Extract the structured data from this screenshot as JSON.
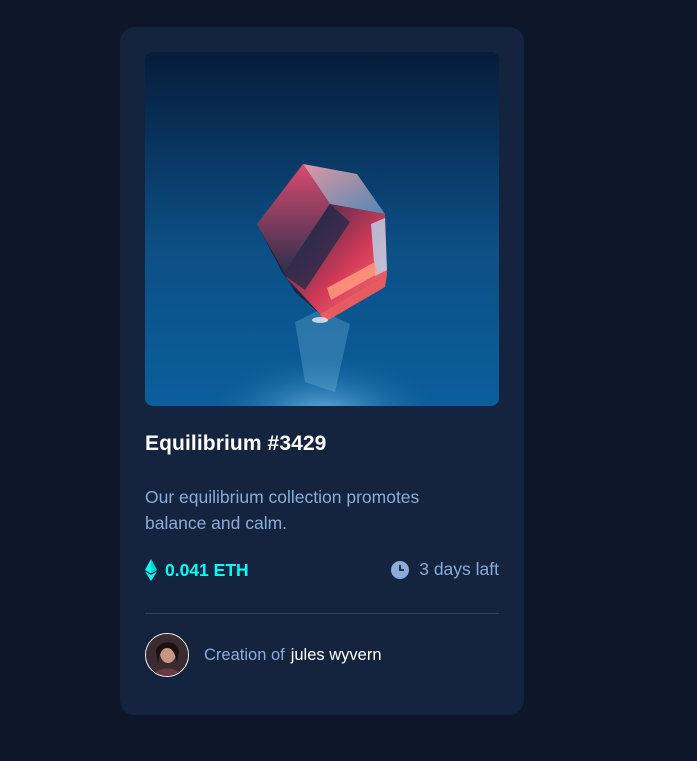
{
  "card": {
    "title": "Equilibrium #3429",
    "description": "Our equilibrium collection promotes balance and calm.",
    "price": "0.041 ETH",
    "time_left": "3 days laft",
    "creator_prefix": "Creation of",
    "creator_name": "jules wyvern"
  },
  "icons": {
    "price": "ethereum-icon",
    "time": "clock-icon"
  },
  "colors": {
    "page_background": "#0e1729",
    "card_background": "#15243e",
    "accent_cyan": "#00fff8",
    "soft_blue": "#8bacd9",
    "white": "#ffffff"
  }
}
